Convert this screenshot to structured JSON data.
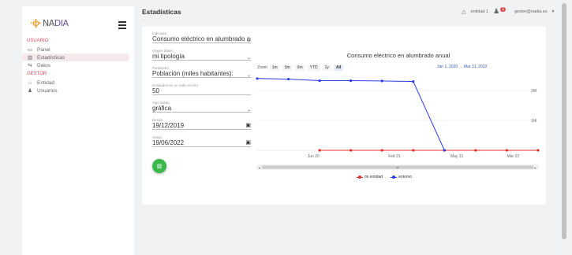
{
  "app": {
    "logo_mark": "·ɸ·",
    "logo_word_a": "NA",
    "logo_word_b": "DIA",
    "logo_sub": "bn"
  },
  "sidebar": {
    "sections": [
      {
        "label": "USUARIO",
        "items": [
          {
            "label": "Panel",
            "icon": "monitor-icon",
            "glyph": "▭",
            "active": false
          },
          {
            "label": "Estadísticas",
            "icon": "bar-chart-icon",
            "glyph": "▥",
            "active": true
          },
          {
            "label": "Datos",
            "icon": "signpost-icon",
            "glyph": "⇆",
            "active": false
          }
        ]
      },
      {
        "label": "GESTOR",
        "items": [
          {
            "label": "Entidad",
            "icon": "home-icon",
            "glyph": "⌂",
            "active": false
          },
          {
            "label": "Usuarios",
            "icon": "user-icon",
            "glyph": "♟",
            "active": false
          }
        ]
      }
    ]
  },
  "header": {
    "title": "Estadísticas",
    "breadcrumb": "-",
    "entity": "entidad 1",
    "notification_count": "1",
    "user": "gestor@nadia.es"
  },
  "form": {
    "indicador": {
      "label": "Indicador",
      "value": "Consumo eléctrico en alumbrado anual"
    },
    "origen": {
      "label": "Origen datos",
      "value": "mi tipología"
    },
    "parametro": {
      "label": "Parámetro",
      "value": "Población (miles habitantes):"
    },
    "entidades": {
      "label": "Entidades en un radio en Km",
      "value": "50"
    },
    "tipo": {
      "label": "Tipo salida",
      "value": "gráfica"
    },
    "desde": {
      "label": "Desde",
      "value": "19/12/2019"
    },
    "hasta": {
      "label": "Hasta",
      "value": "19/06/2022"
    }
  },
  "chart_toolbar": {
    "zoom_label": "Zoom",
    "buttons": [
      "1m",
      "3m",
      "6m",
      "YTD",
      "1y",
      "All"
    ],
    "selected": "All",
    "range_from": "Jan 1, 2020",
    "range_sep": "→",
    "range_to": "Mar 31, 2022"
  },
  "chart_data": {
    "type": "line",
    "title": "Consumo eléctrico en alumbrado anual",
    "x_ticks": [
      "Jun 20",
      "Feb 21",
      "May 21",
      "Mar 22"
    ],
    "y_ticks": [
      "2M",
      "1M"
    ],
    "navigator_label": "III",
    "ylim": [
      0,
      2500000
    ],
    "series": [
      {
        "name": "mi entidad",
        "color": "#e32b2b",
        "x": [
          2020.0,
          2020.25,
          2020.5,
          2020.75,
          2021.0,
          2021.25,
          2021.5,
          2021.75,
          2022.0,
          2022.25
        ],
        "y": [
          null,
          null,
          0,
          0,
          0,
          0,
          0,
          0,
          0,
          0
        ]
      },
      {
        "name": "entorno",
        "color": "#2b3ee3",
        "x": [
          2020.0,
          2020.25,
          2020.5,
          2020.75,
          2021.0,
          2021.25,
          2021.5,
          2021.75,
          2022.0,
          2022.25
        ],
        "y": [
          2400000,
          2380000,
          2330000,
          2330000,
          2320000,
          2300000,
          0,
          null,
          null,
          null
        ]
      }
    ]
  }
}
